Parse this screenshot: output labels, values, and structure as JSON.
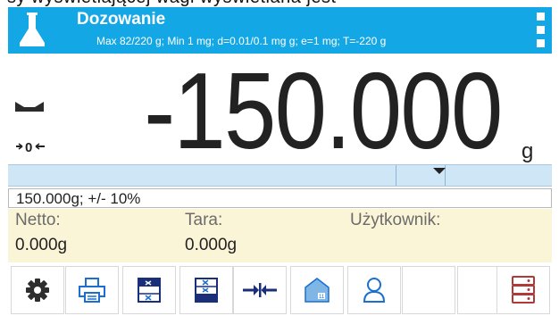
{
  "header": {
    "title": "Dozowanie",
    "subtitle": "Max 82/220 g; Min 1 mg; d=0.01/0.1 mg g; e=1 mg; T=-220 g",
    "app_icon": "flask-icon",
    "menu_icon": "vertical-dots-menu-icon"
  },
  "top_strip_text": "sy wyświetlającej wagi wyświetlana jest",
  "display": {
    "weight": "-150.000",
    "unit": "g",
    "stability_icon": "stability-indicator-icon",
    "zero_icon": "zero-indicator-icon"
  },
  "threshold": {
    "text": "150.000g; +/- 10%"
  },
  "info": {
    "netto_label": "Netto:",
    "netto_value": "0.000g",
    "tara_label": "Tara:",
    "tara_value": "0.000g",
    "user_label": "Użytkownik:"
  },
  "toolbar": [
    {
      "icon": "gear-icon"
    },
    {
      "icon": "print-icon"
    },
    {
      "icon": "database-cancel-icon"
    },
    {
      "icon": "database-add-icon"
    },
    {
      "icon": "zero-arrows-icon"
    },
    {
      "icon": "tare-icon"
    },
    {
      "icon": "user-icon"
    },
    {
      "icon": "empty"
    },
    {
      "icon": "empty"
    },
    {
      "icon": "server-database-icon"
    }
  ],
  "colors": {
    "header_bg": "#14a7e6",
    "info_bg": "#fbf5d8",
    "bar_bg": "#cfe6f7",
    "icon_accent": "#1a6fd1"
  }
}
